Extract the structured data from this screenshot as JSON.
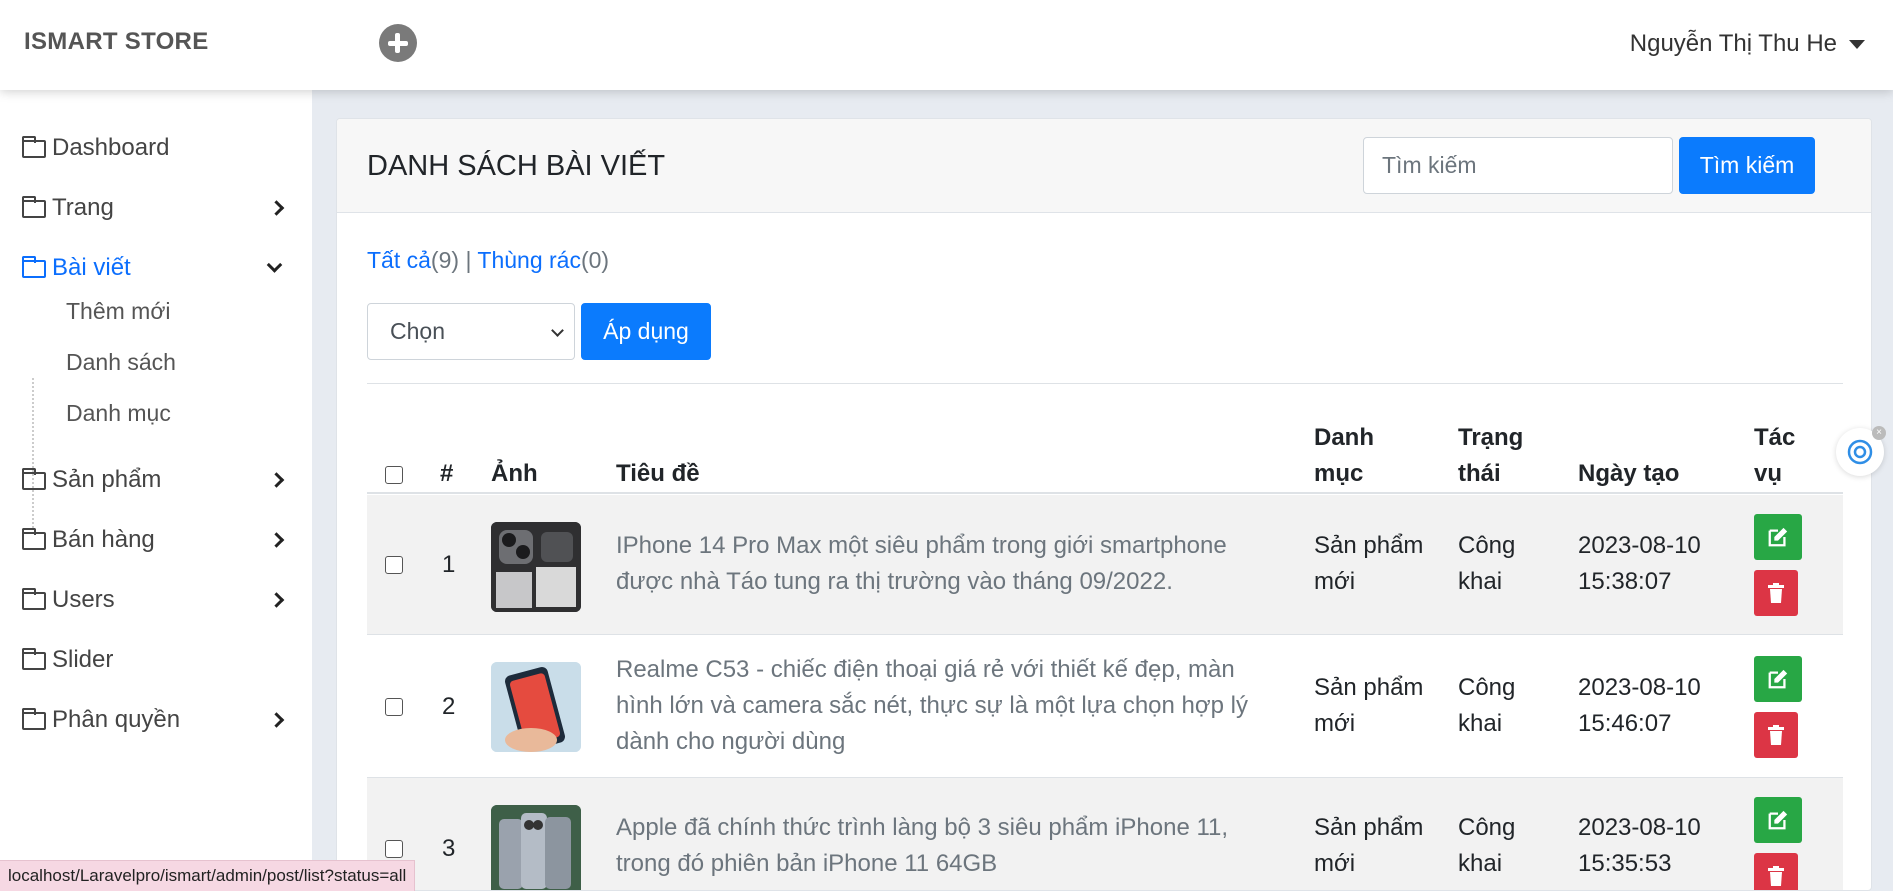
{
  "header": {
    "brand": "ISMART STORE",
    "user_name": "Nguyễn Thị Thu He"
  },
  "sidebar": {
    "items": [
      {
        "label": "Dashboard"
      },
      {
        "label": "Trang"
      },
      {
        "label": "Bài viết"
      },
      {
        "label": "Sản phẩm"
      },
      {
        "label": "Bán hàng"
      },
      {
        "label": "Users"
      },
      {
        "label": "Slider"
      },
      {
        "label": "Phân quyền"
      }
    ],
    "sub_items": [
      {
        "label": "Thêm mới"
      },
      {
        "label": "Danh sách"
      },
      {
        "label": "Danh mục"
      }
    ]
  },
  "main": {
    "title": "DANH SÁCH BÀI VIẾT",
    "search_placeholder": "Tìm kiếm",
    "search_button": "Tìm kiếm",
    "filter_all": "Tất cả",
    "filter_all_count": "(9)",
    "filter_sep": "|",
    "filter_trash": "Thùng rác",
    "filter_trash_count": "(0)",
    "bulk_select": "Chọn",
    "apply_button": "Áp dụng"
  },
  "table": {
    "headers": {
      "num": "#",
      "image": "Ảnh",
      "title": "Tiêu đề",
      "category_1": "Danh",
      "category_2": "mục",
      "status_1": "Trạng",
      "status_2": "thái",
      "created": "Ngày tạo",
      "actions_1": "Tác",
      "actions_2": "vụ"
    },
    "rows": [
      {
        "num": "1",
        "title_1": "IPhone 14 Pro Max một siêu phẩm trong giới smartphone",
        "title_2": "được nhà Táo tung ra thị trường vào tháng 09/2022.",
        "title_3": "",
        "cat_1": "Sản phẩm",
        "cat_2": "mới",
        "status_1": "Công",
        "status_2": "khai",
        "date": "2023-08-10",
        "time": "15:38:07"
      },
      {
        "num": "2",
        "title_1": "Realme C53 - chiếc điện thoại giá rẻ với thiết kế đẹp, màn",
        "title_2": "hình lớn và camera sắc nét, thực sự là một lựa chọn hợp lý",
        "title_3": "dành cho người dùng",
        "cat_1": "Sản phẩm",
        "cat_2": "mới",
        "status_1": "Công",
        "status_2": "khai",
        "date": "2023-08-10",
        "time": "15:46:07"
      },
      {
        "num": "3",
        "title_1": "Apple đã chính thức trình làng bộ 3 siêu phẩm iPhone 11,",
        "title_2": "trong đó phiên bản iPhone 11 64GB",
        "title_3": "",
        "cat_1": "Sản phẩm",
        "cat_2": "mới",
        "status_1": "Công",
        "status_2": "khai",
        "date": "2023-08-10",
        "time": "15:35:53"
      }
    ]
  },
  "statusbar": {
    "url": "localhost/Laravelpro/ismart/admin/post/list?status=all"
  },
  "colors": {
    "primary": "#0b7bfd",
    "link": "#0b6efd",
    "success": "#28a745",
    "danger": "#dc3545",
    "stripe": "#f2f2f2"
  },
  "icons": [
    "plus-circle-icon",
    "caret-down-icon",
    "folder-icon",
    "chevron-right-icon",
    "chevron-down-icon",
    "edit-icon",
    "trash-icon",
    "assistant-icon"
  ]
}
